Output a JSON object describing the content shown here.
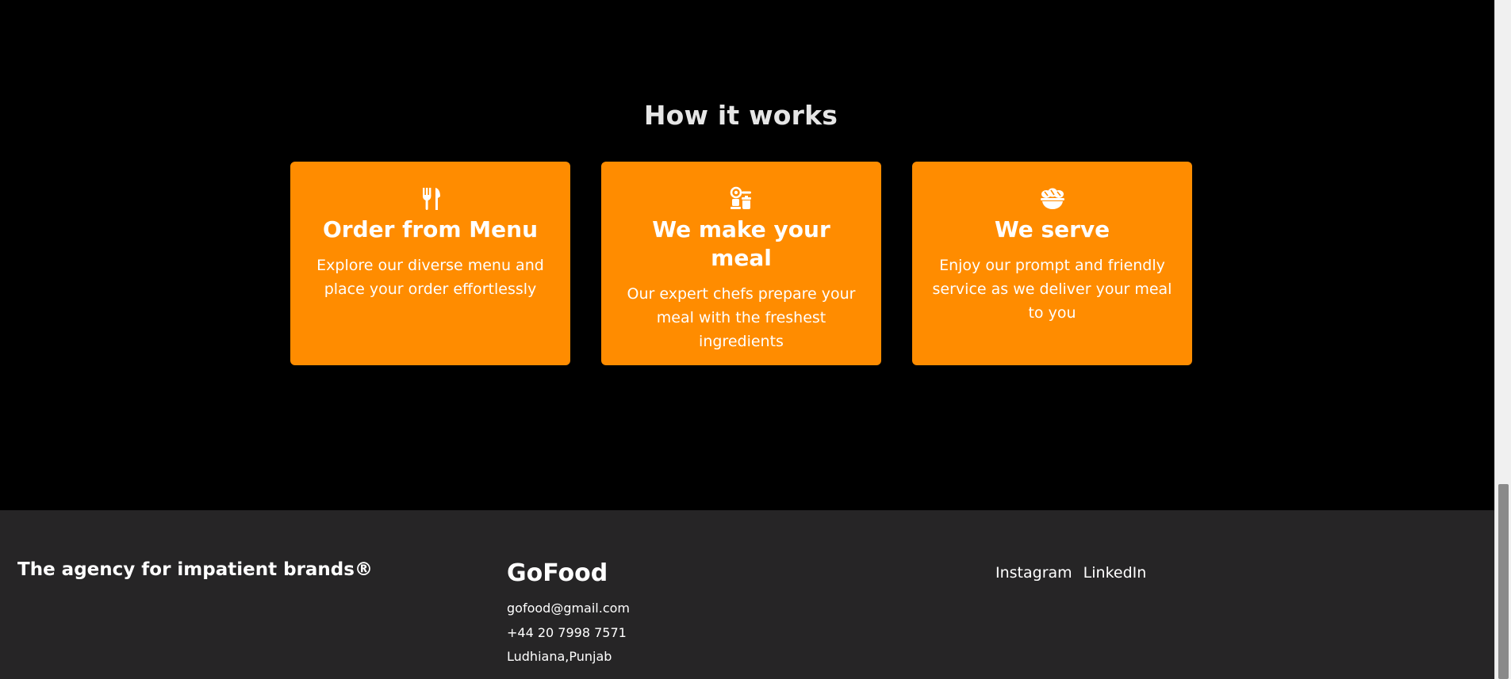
{
  "how_it_works": {
    "title": "How it works",
    "cards": [
      {
        "icon": "utensils-icon",
        "title": "Order from Menu",
        "text": "Explore our diverse menu and place your order effortlessly"
      },
      {
        "icon": "kitchen-icon",
        "title": "We make your meal",
        "text": "Our expert chefs prepare your meal with the freshest ingredients"
      },
      {
        "icon": "bread-bowl-icon",
        "title": "We serve",
        "text": "Enjoy our prompt and friendly service as we deliver your meal to you"
      }
    ]
  },
  "footer": {
    "tagline": "The agency for impatient brands®",
    "brand": "GoFood",
    "email": "gofood@gmail.com",
    "phone": "+44 20 7998 7571",
    "address": "Ludhiana,Punjab",
    "social": [
      "Instagram",
      "LinkedIn"
    ]
  },
  "colors": {
    "accent": "#ff8c00",
    "background": "#000000",
    "footer_background": "#262526"
  }
}
